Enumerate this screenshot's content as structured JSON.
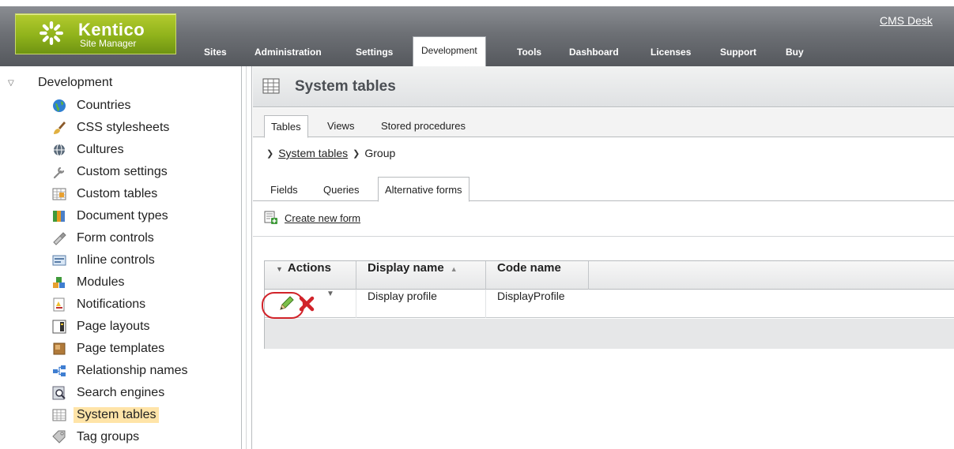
{
  "header": {
    "logo_brand": "Kentico",
    "logo_sub": "Site Manager",
    "cms_desk": "CMS Desk",
    "tabs": [
      {
        "label": "Sites"
      },
      {
        "label": "Administration"
      },
      {
        "label": "Settings"
      },
      {
        "label": "Development",
        "active": true
      },
      {
        "label": "Tools"
      },
      {
        "label": "Dashboard"
      },
      {
        "label": "Licenses"
      },
      {
        "label": "Support"
      },
      {
        "label": "Buy"
      }
    ]
  },
  "tree": {
    "root": "Development",
    "items": [
      {
        "label": "Countries",
        "icon": "globe-icon"
      },
      {
        "label": "CSS stylesheets",
        "icon": "brush-icon"
      },
      {
        "label": "Cultures",
        "icon": "culture-globe-icon"
      },
      {
        "label": "Custom settings",
        "icon": "wrench-icon"
      },
      {
        "label": "Custom tables",
        "icon": "custom-table-icon"
      },
      {
        "label": "Document types",
        "icon": "document-types-icon"
      },
      {
        "label": "Form controls",
        "icon": "form-controls-icon"
      },
      {
        "label": "Inline controls",
        "icon": "inline-controls-icon"
      },
      {
        "label": "Modules",
        "icon": "modules-icon"
      },
      {
        "label": "Notifications",
        "icon": "notifications-icon"
      },
      {
        "label": "Page layouts",
        "icon": "page-layout-icon"
      },
      {
        "label": "Page templates",
        "icon": "page-template-icon"
      },
      {
        "label": "Relationship names",
        "icon": "relationship-icon"
      },
      {
        "label": "Search engines",
        "icon": "search-engine-icon"
      },
      {
        "label": "System tables",
        "icon": "system-table-icon",
        "selected": true
      },
      {
        "label": "Tag groups",
        "icon": "tag-groups-icon"
      }
    ]
  },
  "content": {
    "title": "System tables",
    "tabs": [
      {
        "label": "Tables",
        "active": true
      },
      {
        "label": "Views"
      },
      {
        "label": "Stored procedures"
      }
    ],
    "breadcrumb": {
      "link": "System tables",
      "current": "Group"
    },
    "subtabs": [
      {
        "label": "Fields"
      },
      {
        "label": "Queries"
      },
      {
        "label": "Alternative forms",
        "active": true
      }
    ],
    "create_new_form": "Create new form",
    "grid": {
      "columns": [
        "Actions",
        "Display name",
        "Code name"
      ],
      "rows": [
        {
          "display_name": "Display profile",
          "code_name": "DisplayProfile"
        }
      ]
    }
  },
  "colors": {
    "accent_green": "#8fb21b",
    "header_gray": "#6d7075",
    "selected_bg": "#ffe4a8",
    "delete_red": "#d1232a",
    "highlight_ring": "#d1232a"
  }
}
